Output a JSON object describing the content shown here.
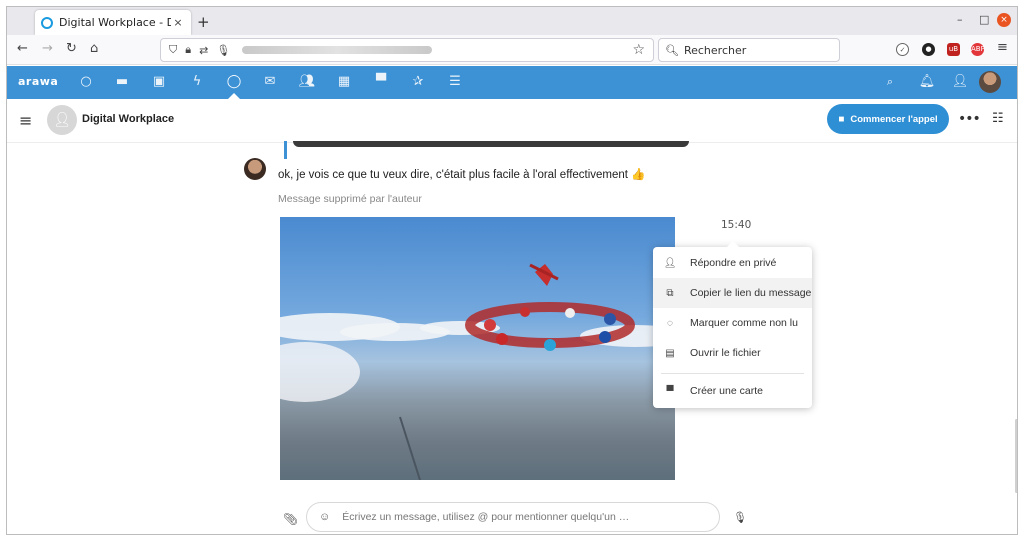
{
  "browser": {
    "tab_title": "Digital Workplace - Discu",
    "tab_close": "×",
    "new_tab": "+",
    "url_blurred": true,
    "search_placeholder": "Rechercher",
    "window_controls": {
      "minimize": "–",
      "maximize": "□",
      "close": "×"
    }
  },
  "app": {
    "logo": "arawa",
    "accent_color": "#3d92d6",
    "nav_icons": [
      "circle-icon",
      "folder-icon",
      "image-icon",
      "activity-icon",
      "talk-icon",
      "mail-icon",
      "contacts-icon",
      "calendar-icon",
      "deck-icon",
      "star-icon",
      "notes-icon"
    ],
    "right_icons": [
      "search-icon",
      "notifications-icon",
      "contacts-menu-icon",
      "user-avatar"
    ]
  },
  "conversation": {
    "title": "Digital Workplace",
    "call_button": "Commencer l'appel"
  },
  "messages": {
    "text": "ok, je vois ce que tu veux dire, c'était plus facile à l'oral effectivement 👍",
    "deleted": "Message supprimé par l'auteur",
    "timestamp": "15:40"
  },
  "context_menu": {
    "items": [
      {
        "label": "Répondre en privé",
        "icon": "person-icon"
      },
      {
        "label": "Copier le lien du message",
        "icon": "external-link-icon"
      },
      {
        "label": "Marquer comme non lu",
        "icon": "eye-off-icon"
      },
      {
        "label": "Ouvrir le fichier",
        "icon": "file-icon"
      },
      {
        "label": "Créer une carte",
        "icon": "deck-card-icon"
      }
    ]
  },
  "composer": {
    "placeholder": "Écrivez un message, utilisez @ pour mentionner quelqu'un …"
  }
}
